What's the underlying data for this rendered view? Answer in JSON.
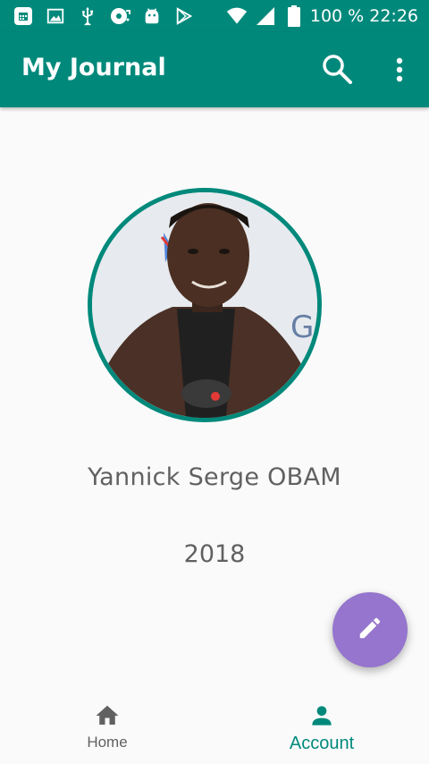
{
  "colors": {
    "primary": "#00897b",
    "accent": "#9575cd",
    "text_secondary": "#616161",
    "background": "#fafafa"
  },
  "status_bar": {
    "left_icons": [
      "calendar-icon",
      "image-icon",
      "usb-icon",
      "sync-icon",
      "android-icon",
      "play-store-icon"
    ],
    "right_icons": [
      "wifi-icon",
      "signal-icon",
      "battery-icon"
    ],
    "battery": "100 %",
    "time": "22:26"
  },
  "app_bar": {
    "title": "My Journal",
    "actions": [
      "search-icon",
      "more-vert-icon"
    ]
  },
  "profile": {
    "name": "Yannick Serge OBAM",
    "year": "2018"
  },
  "fab": {
    "icon": "edit-pencil-icon"
  },
  "bottom_nav": {
    "items": [
      {
        "label": "Home",
        "icon": "home-icon",
        "active": false
      },
      {
        "label": "Account",
        "icon": "person-icon",
        "active": true
      }
    ]
  }
}
